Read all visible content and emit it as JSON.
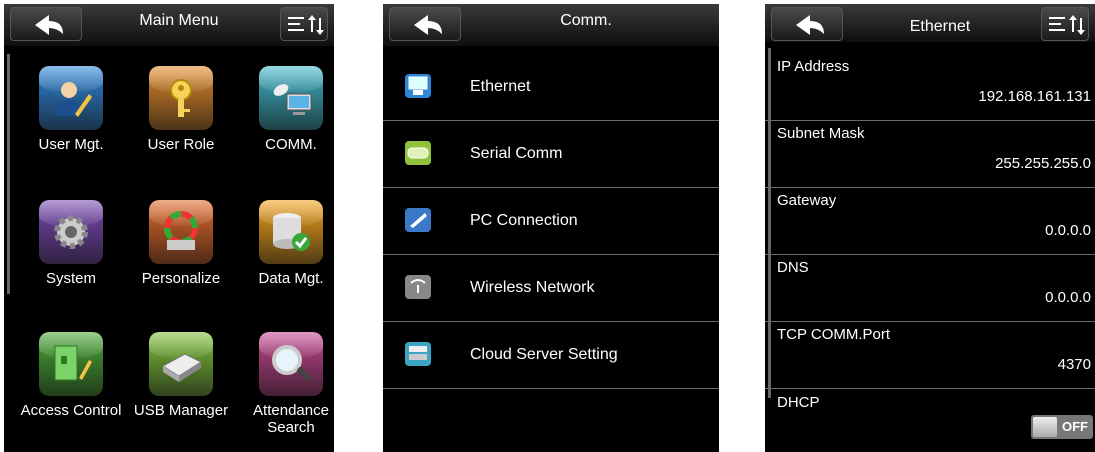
{
  "main_menu": {
    "title": "Main Menu",
    "tiles": [
      {
        "label": "User Mgt.",
        "icon": "user-mgt-icon",
        "color": "#2f86d8"
      },
      {
        "label": "User Role",
        "icon": "key-icon",
        "color": "#e08a2a"
      },
      {
        "label": "COMM.",
        "icon": "comm-icon",
        "color": "#3fb6c9"
      },
      {
        "label": "System",
        "icon": "gear-icon",
        "color": "#7a4ab5"
      },
      {
        "label": "Personalize",
        "icon": "color-wheel-icon",
        "color": "#e36a2b"
      },
      {
        "label": "Data Mgt.",
        "icon": "database-icon",
        "color": "#f0a21c"
      },
      {
        "label": "Access Control",
        "icon": "door-icon",
        "color": "#49a835"
      },
      {
        "label": "USB Manager",
        "icon": "usb-drive-icon",
        "color": "#7fc03a"
      },
      {
        "label": "Attendance Search",
        "icon": "magnifier-icon",
        "color": "#c4468f"
      }
    ]
  },
  "comm": {
    "title": "Comm.",
    "items": [
      {
        "label": "Ethernet",
        "icon": "ethernet-icon",
        "color": "#2e86d6"
      },
      {
        "label": "Serial Comm",
        "icon": "serial-port-icon",
        "color": "#8fc23a"
      },
      {
        "label": "PC Connection",
        "icon": "pc-connection-icon",
        "color": "#3b78c8"
      },
      {
        "label": "Wireless Network",
        "icon": "wireless-icon",
        "color": "#888888"
      },
      {
        "label": "Cloud Server Setting",
        "icon": "cloud-server-icon",
        "color": "#3ba6c4"
      }
    ]
  },
  "ethernet": {
    "title": "Ethernet",
    "settings": [
      {
        "name": "IP Address",
        "value": "192.168.161.131"
      },
      {
        "name": "Subnet Mask",
        "value": "255.255.255.0"
      },
      {
        "name": "Gateway",
        "value": "0.0.0.0"
      },
      {
        "name": "DNS",
        "value": "0.0.0.0"
      },
      {
        "name": "TCP COMM.Port",
        "value": "4370"
      }
    ],
    "dhcp": {
      "name": "DHCP",
      "state": "OFF"
    }
  }
}
